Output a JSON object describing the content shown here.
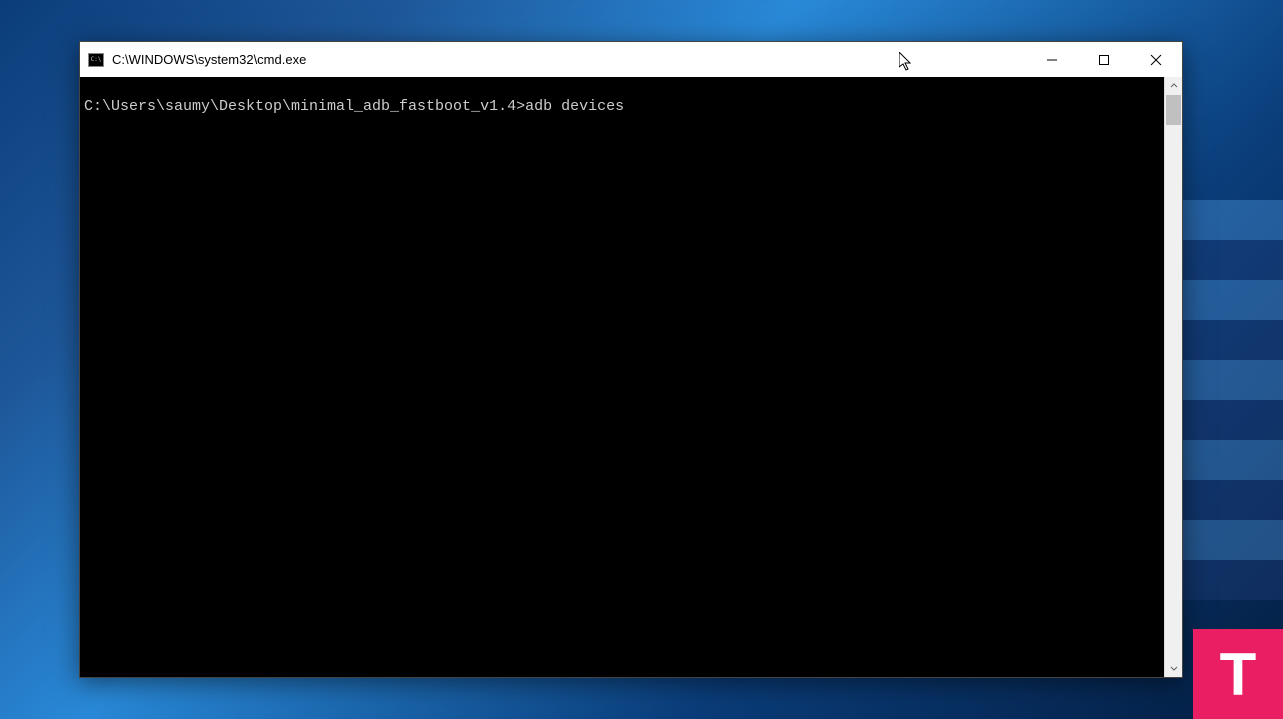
{
  "window": {
    "title": "C:\\WINDOWS\\system32\\cmd.exe"
  },
  "terminal": {
    "prompt": "C:\\Users\\saumy\\Desktop\\minimal_adb_fastboot_v1.4>",
    "command": "adb devices"
  },
  "logo": {
    "letter": "T"
  }
}
